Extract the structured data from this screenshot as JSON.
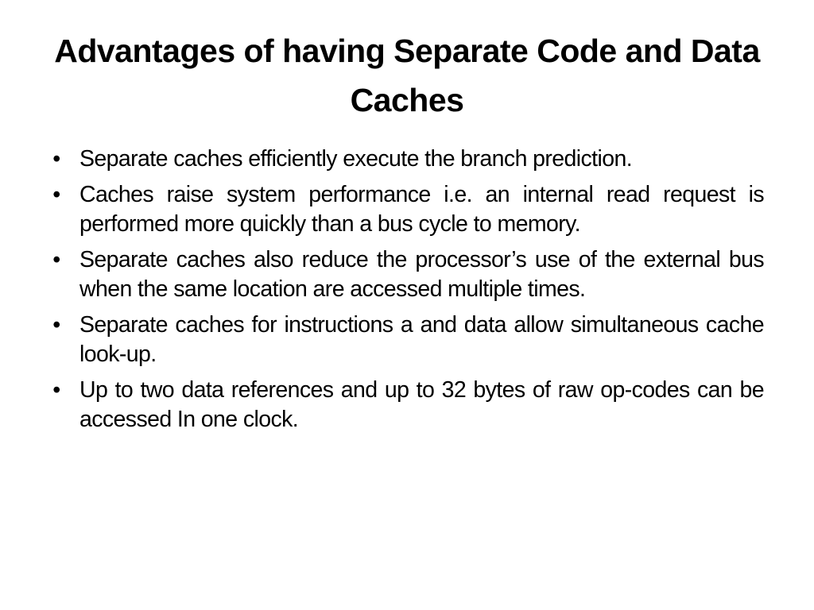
{
  "slide": {
    "title": "Advantages of having Separate Code and Data Caches",
    "bullet_glyph": "•",
    "bullets": [
      "Separate caches efficiently execute the branch prediction.",
      "Caches raise system performance i.e. an internal read request is performed more quickly than a bus cycle to memory.",
      "Separate caches also reduce the processor’s use of the external bus when the same location are accessed multiple times.",
      "Separate caches for instructions a and data allow simultaneous cache look-up.",
      "Up to two data references and up to 32 bytes of raw op-codes can be accessed In one clock."
    ]
  }
}
